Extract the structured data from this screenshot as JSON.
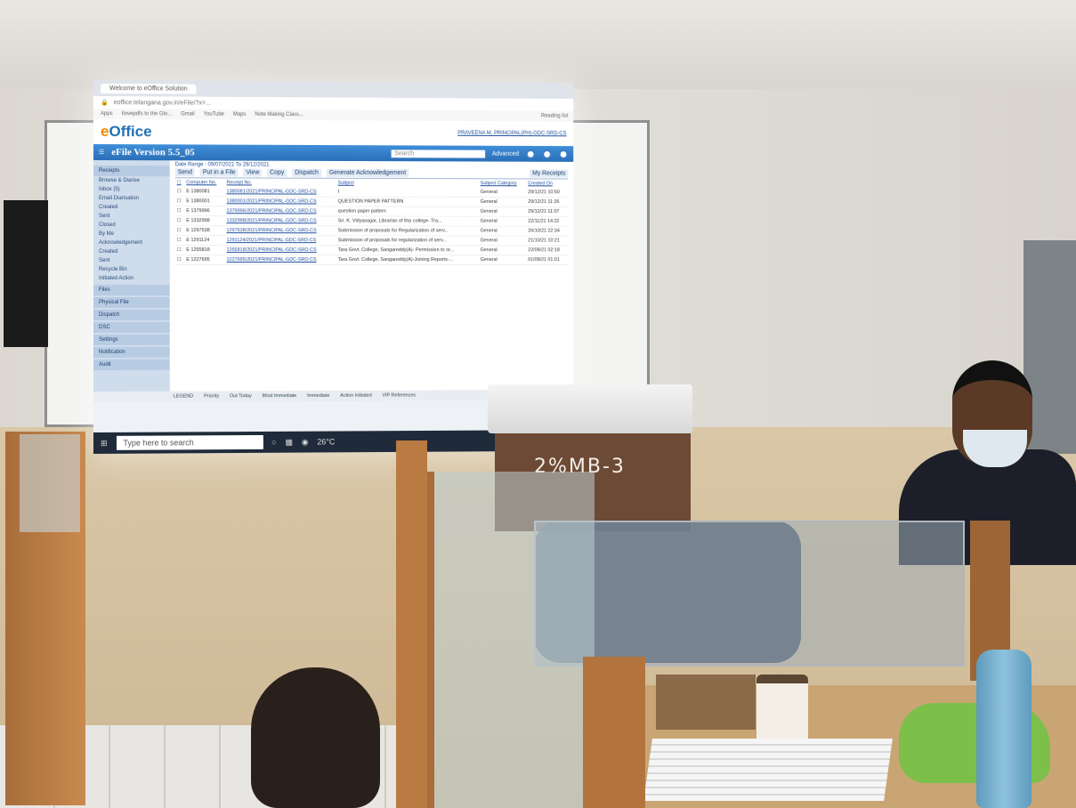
{
  "browser": {
    "tab_title": "Welcome to eOffice Solution",
    "address": "eoffice.telangana.gov.in/eFile/?x=...",
    "bookmarks": [
      "Apps",
      "Ilovepdfs to the Glo...",
      "Gmail",
      "YouTube",
      "Maps",
      "Note Making Class..."
    ],
    "reading_list": "Reading list"
  },
  "eoffice": {
    "logo_pre": "e",
    "logo_main": "Office",
    "user": "PRAVEENA M, PRINCIPAL(PH)-GDC-SRD-CS",
    "app_title": "eFile Version 5.5_05",
    "search_placeholder": "Search",
    "advanced": "Advanced",
    "sidebar": {
      "receipts_head": "Receipts",
      "items": [
        "Browse & Diarise",
        "Inbox (5)",
        "Email Diarisation",
        "Created",
        "Sent",
        "Closed",
        "By Me",
        "Acknowledgement",
        "Created",
        "Sent",
        "Recycle Bin",
        "Initiated Action"
      ],
      "sections": [
        "Files",
        "Physical File",
        "Dispatch",
        "DSC",
        "Settings",
        "Notification",
        "Audit"
      ]
    },
    "date_range": "Date Range : 09/07/2021 To 29/12/2021",
    "actions": [
      "Send",
      "Put in a File",
      "View",
      "Copy",
      "Dispatch",
      "Generate Acknowledgement"
    ],
    "filter": "My Receipts",
    "columns": [
      "Computer No.",
      "Receipt No.",
      "Subject",
      "Subject Category",
      "Created On"
    ],
    "rows": [
      [
        "E 1380081",
        "1380081/2021/PRINCIPAL-GDC-SRD-CS",
        "t",
        "General",
        "29/12/21 10:50"
      ],
      [
        "E 1380001",
        "1380001/2021/PRINCIPAL-GDC-SRD-CS",
        "QUESTION PAPER PATTERN",
        "General",
        "29/12/21 11:26"
      ],
      [
        "E 1379996",
        "1379996/2021/PRINCIPAL-GDC-SRD-CS",
        "question paper pattern",
        "General",
        "29/12/21 11:07"
      ],
      [
        "E 1332998",
        "1332998/2021/PRINCIPAL-GDC-SRD-CS",
        "Sri. K. Vidyasagar, Librarian of this college- Tra...",
        "General",
        "22/11/21 14:22"
      ],
      [
        "E 1297538",
        "1297538/2021/PRINCIPAL-GDC-SRD-CS",
        "Submission of proposals for Regularization of serv...",
        "General",
        "26/10/21 22:34"
      ],
      [
        "E 1291124",
        "1291124/2021/PRINCIPAL-GDC-SRD-CS",
        "Submission of proposals for regularization of serv...",
        "General",
        "21/10/21 10:21"
      ],
      [
        "E 1255818",
        "1255818/2021/PRINCIPAL-GDC-SRD-CS",
        "Tara Govt. College, Sangareddy(A)- Permission to or...",
        "General",
        "22/09/21 02:18"
      ],
      [
        "E 1227695",
        "1227695/2021/PRINCIPAL-GDC-SRD-CS",
        "Tara Govt. College, Sangareddy(A)-Joining Reports-...",
        "General",
        "01/09/21 01:01"
      ]
    ],
    "legend": [
      "LEGEND",
      "Priority",
      "Out Today",
      "Most Immediate",
      "Immediate",
      "Action Initiated",
      "VIP References"
    ]
  },
  "taskbar": {
    "search": "Type here to search",
    "weather": "26°C"
  },
  "stand_label": "2%MB-3",
  "colors": {
    "eoffice_blue": "#2a6fb8",
    "logo_orange": "#f08a00",
    "stand_brown": "#6d4a35"
  }
}
